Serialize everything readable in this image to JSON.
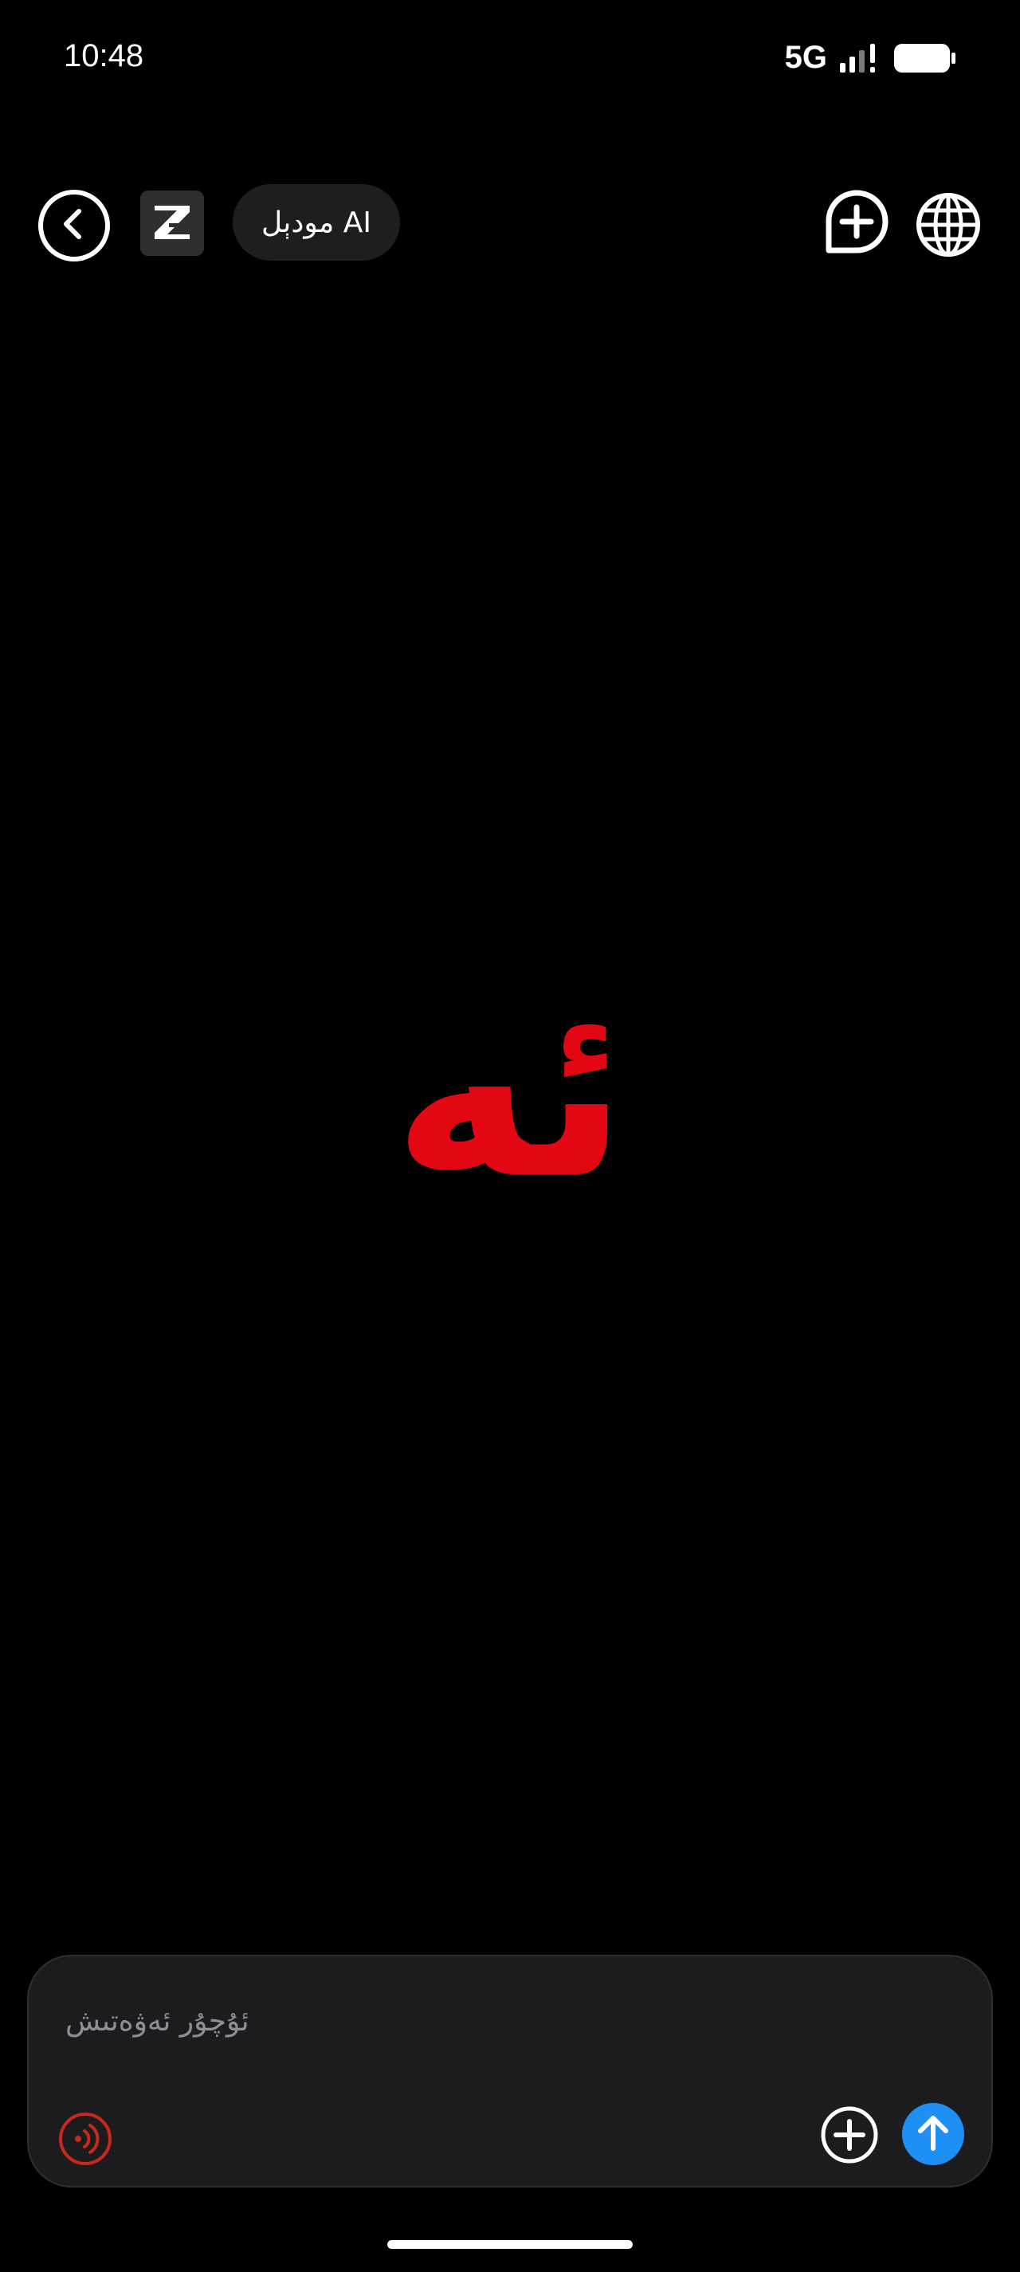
{
  "status_bar": {
    "time": "10:48",
    "network": "5G",
    "signal_icon": "signal-bars-icon",
    "battery_icon": "battery-icon"
  },
  "header": {
    "back_icon": "chevron-left-icon",
    "logo_icon": "z-logo-icon",
    "model_label": "مودېل AI",
    "new_chat_icon": "chat-plus-icon",
    "language_icon": "globe-icon"
  },
  "main": {
    "glyph": "ئە"
  },
  "composer": {
    "placeholder": "ئۇچۇر ئەۋەتىش",
    "value": "",
    "voice_icon": "voice-wave-icon",
    "attach_icon": "plus-circle-icon",
    "send_icon": "arrow-up-icon"
  },
  "colors": {
    "background": "#000000",
    "accent_red": "#e30613",
    "send_blue": "#1e8ff5",
    "panel": "#1c1c1e",
    "placeholder": "#8e8e93"
  }
}
